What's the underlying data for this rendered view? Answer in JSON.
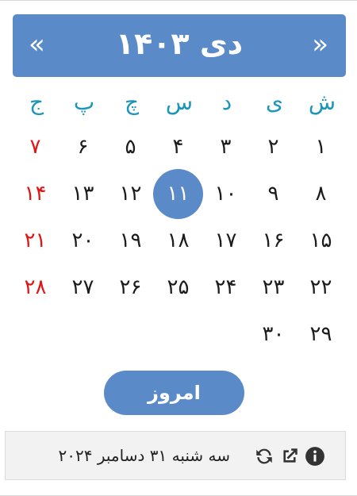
{
  "header": {
    "month_year": "دی ۱۴۰۳",
    "prev_symbol": "«",
    "next_symbol": "»"
  },
  "weekdays": [
    "ش",
    "ی",
    "د",
    "س",
    "چ",
    "پ",
    "ج"
  ],
  "weeks": [
    [
      "۱",
      "۲",
      "۳",
      "۴",
      "۵",
      "۶",
      "۷"
    ],
    [
      "۸",
      "۹",
      "۱۰",
      "۱۱",
      "۱۲",
      "۱۳",
      "۱۴"
    ],
    [
      "۱۵",
      "۱۶",
      "۱۷",
      "۱۸",
      "۱۹",
      "۲۰",
      "۲۱"
    ],
    [
      "۲۲",
      "۲۳",
      "۲۴",
      "۲۵",
      "۲۶",
      "۲۷",
      "۲۸"
    ],
    [
      "۲۹",
      "۳۰",
      "",
      "",
      "",
      "",
      ""
    ]
  ],
  "selected_day": "۱۱",
  "today_button": "امروز",
  "footer": {
    "date_text": "سه شنبه ۳۱ دسامبر ۲۰۲۴",
    "icons": [
      "info-icon",
      "external-link-icon",
      "refresh-icon"
    ]
  },
  "colors": {
    "accent": "#5b8ac8",
    "weekday": "#1b96b8",
    "holiday": "#e01515"
  }
}
